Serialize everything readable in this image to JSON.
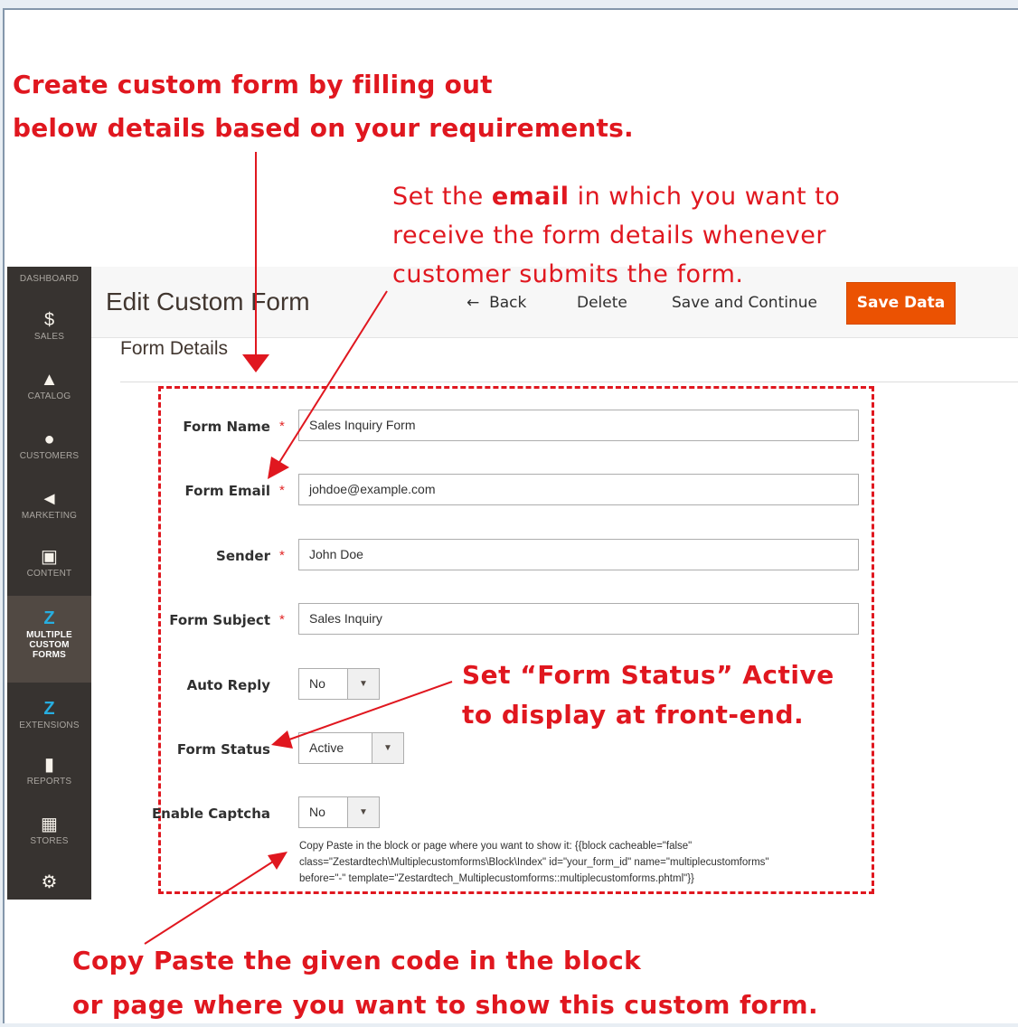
{
  "annotations": {
    "create_line1": "Create custom form by filling out",
    "create_line2": "below details based on your requirements.",
    "email_line1_pre": "Set the ",
    "email_line1_bold": "email",
    "email_line1_post": " in which you want to",
    "email_line2": "receive the form details whenever",
    "email_line3": "customer submits the form.",
    "status_line1": "Set “Form Status” Active",
    "status_line2": "to display at front-end.",
    "copy_line1": "Copy Paste the given code in the block",
    "copy_line2": "or page where you want to show this custom form."
  },
  "sidebar": {
    "top_label": "DASHBOARD",
    "items": [
      {
        "label": "SALES",
        "icon": "dollar-icon"
      },
      {
        "label": "CATALOG",
        "icon": "box-icon"
      },
      {
        "label": "CUSTOMERS",
        "icon": "person-icon"
      },
      {
        "label": "MARKETING",
        "icon": "megaphone-icon"
      },
      {
        "label": "CONTENT",
        "icon": "layout-icon"
      },
      {
        "label1": "MULTIPLE",
        "label2": "CUSTOM",
        "label3": "FORMS",
        "icon": "zestard-logo-icon"
      },
      {
        "label": "EXTENSIONS",
        "icon": "zestard-logo-icon"
      },
      {
        "label": "REPORTS",
        "icon": "bar-chart-icon"
      },
      {
        "label": "STORES",
        "icon": "store-icon"
      },
      {
        "label": "",
        "icon": "gear-icon"
      }
    ]
  },
  "header": {
    "title": "Edit Custom Form",
    "back": "Back",
    "delete": "Delete",
    "save_continue": "Save and Continue",
    "save": "Save Data"
  },
  "section_title": "Form Details",
  "form": {
    "form_name_label": "Form Name",
    "form_name_value": "Sales Inquiry Form",
    "form_email_label": "Form Email",
    "form_email_value": "johdoe@example.com",
    "sender_label": "Sender",
    "sender_value": "John Doe",
    "subject_label": "Form Subject",
    "subject_value": "Sales Inquiry",
    "auto_reply_label": "Auto Reply",
    "auto_reply_value": "No",
    "status_label": "Form Status",
    "status_value": "Active",
    "captcha_label": "Enable Captcha",
    "captcha_value": "No",
    "code_line1": "Copy Paste in the block or page where you want to show it: {{block cacheable=\"false\"",
    "code_line2": "class=\"Zestardtech\\Multiplecustomforms\\Block\\Index\" id=\"your_form_id\" name=\"multiplecustomforms\"",
    "code_line3": "before=\"-\" template=\"Zestardtech_Multiplecustomforms::multiplecustomforms.phtml\"}}",
    "required_mark": "*"
  },
  "colors": {
    "annotation_red": "#e0171f",
    "sidebar_bg": "#373330",
    "save_orange": "#eb5202"
  }
}
